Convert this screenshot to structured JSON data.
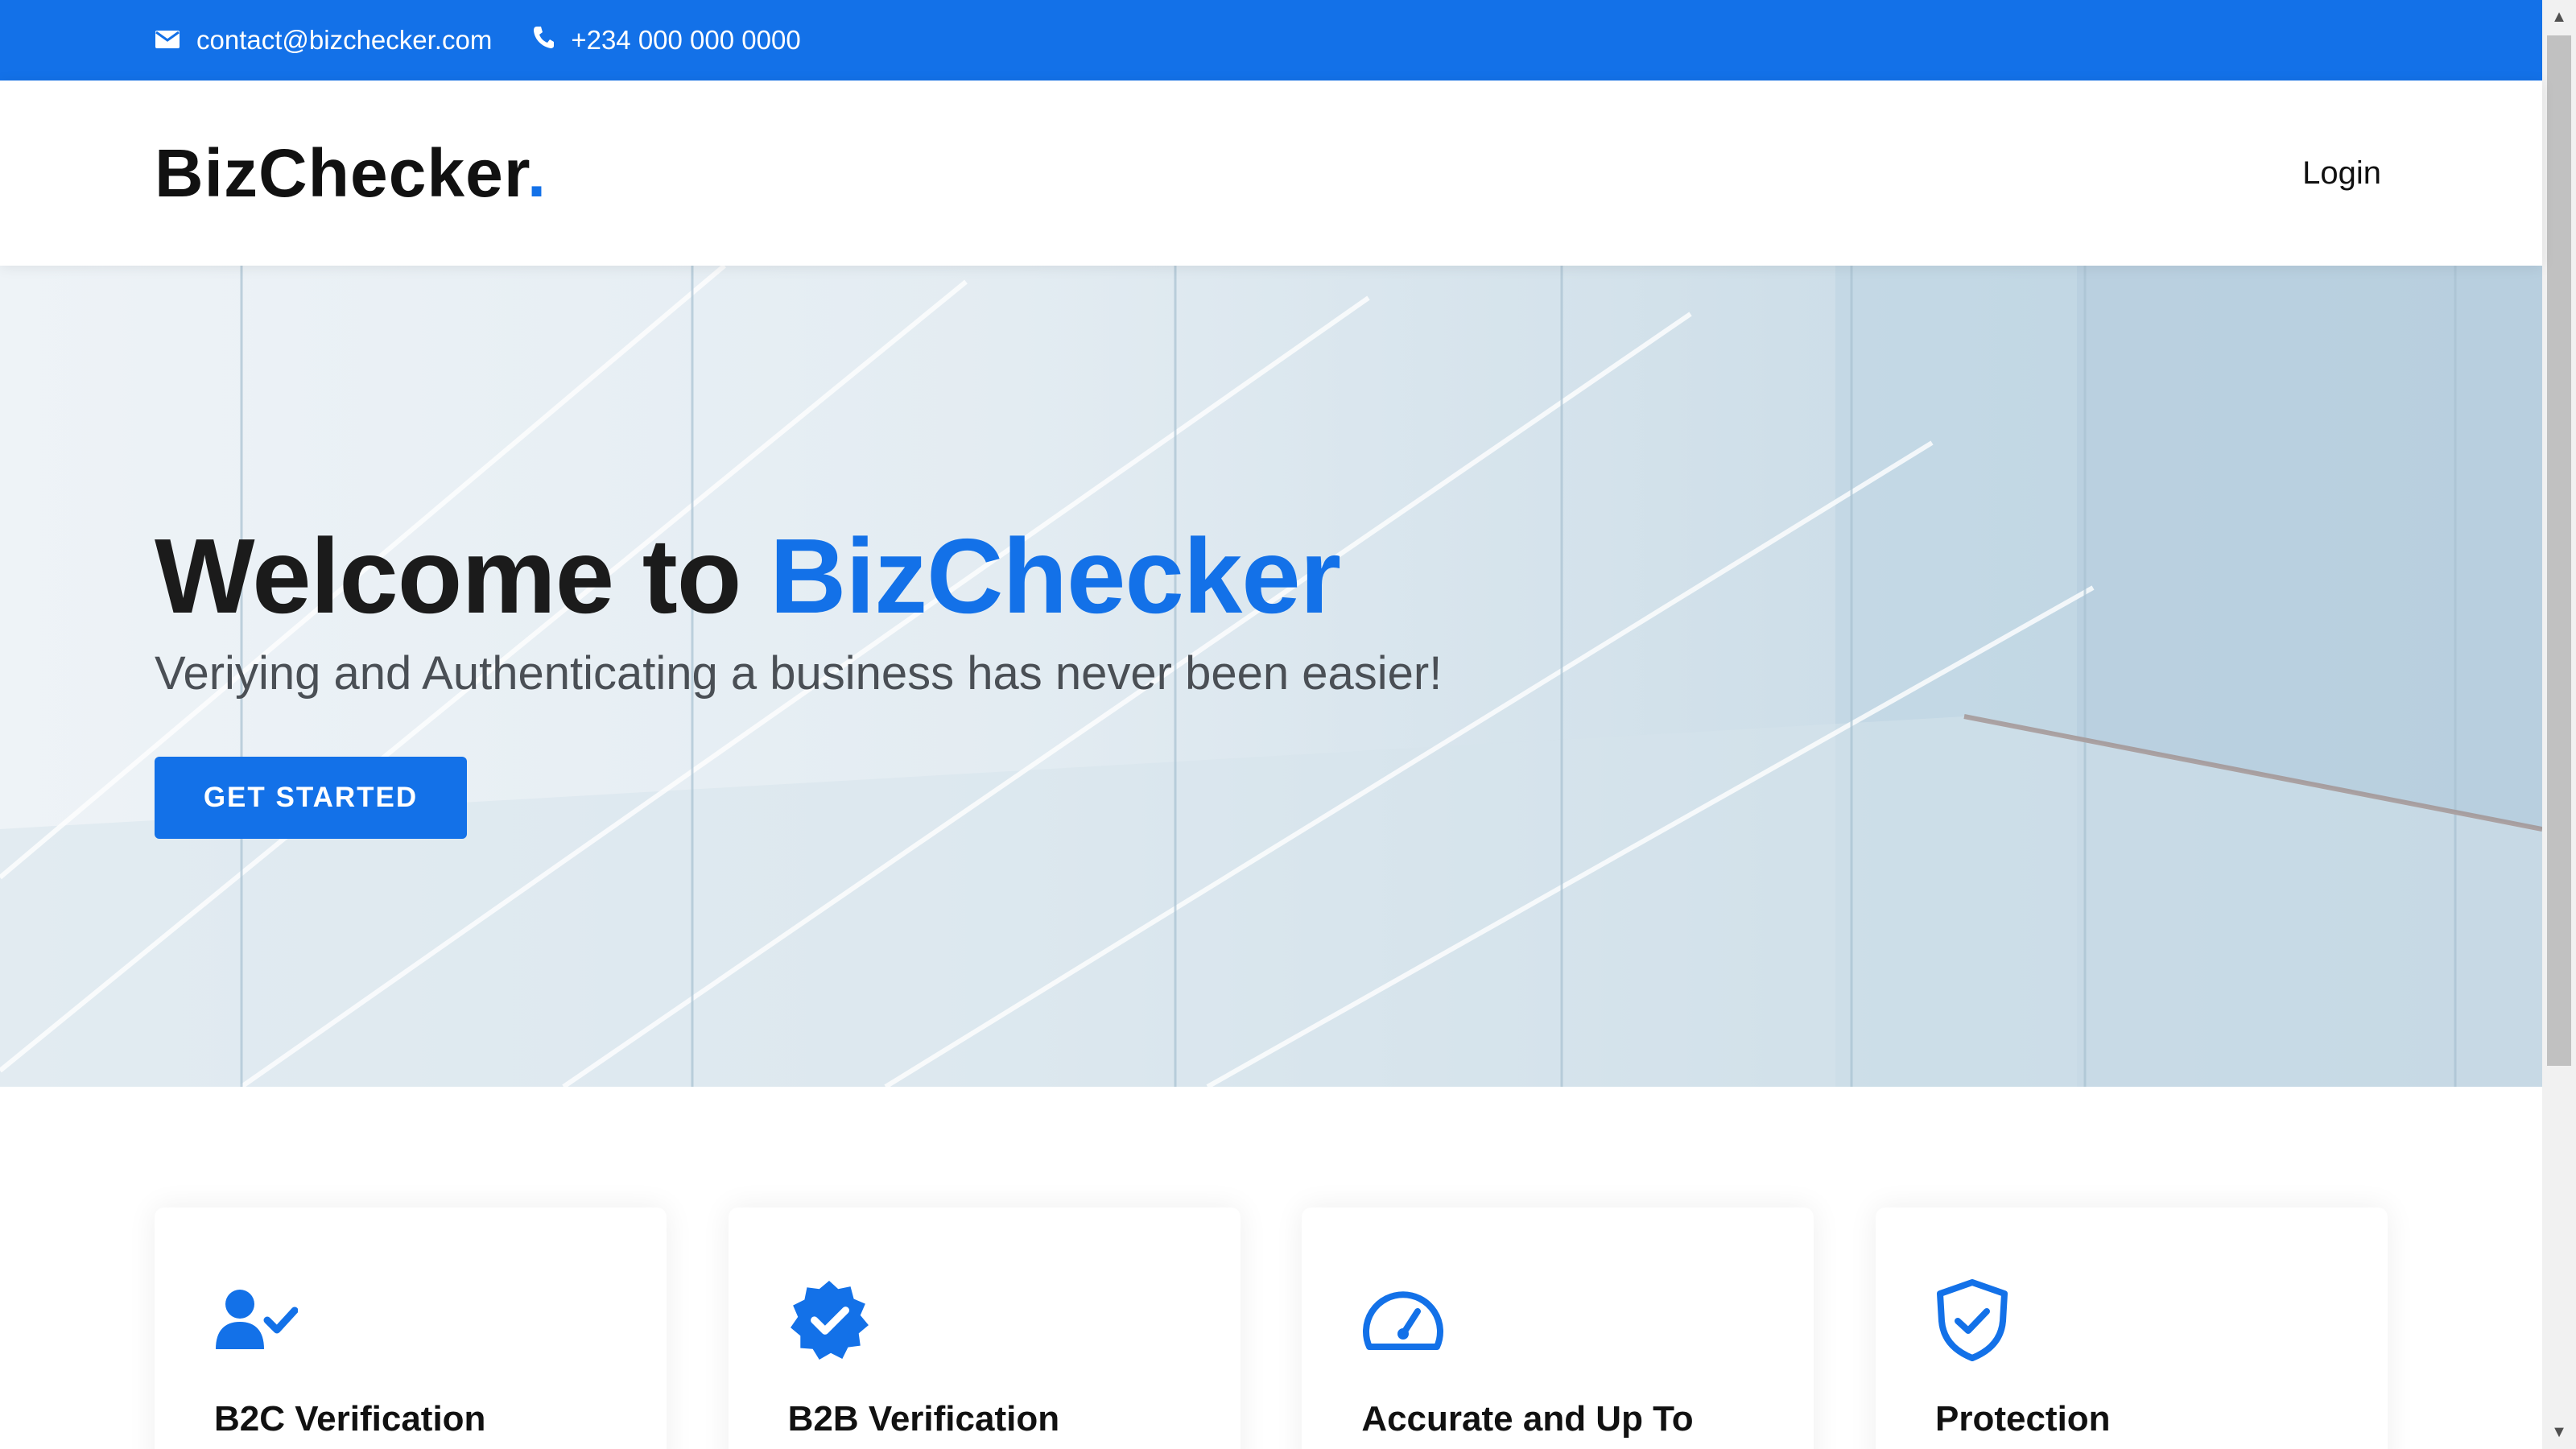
{
  "topbar": {
    "email": "contact@bizchecker.com",
    "phone": "+234 000 000 0000"
  },
  "header": {
    "logo_text": "BizChecker",
    "logo_dot": ".",
    "login_label": "Login"
  },
  "hero": {
    "title_prefix": "Welcome to ",
    "title_brand": "BizChecker",
    "subtitle": "Veriying and Authenticating a business has never been easier!",
    "cta_label": "GET STARTED"
  },
  "features": [
    {
      "title": "B2C Verification",
      "icon": "user-check-icon"
    },
    {
      "title": "B2B Verification",
      "icon": "verified-badge-icon"
    },
    {
      "title": "Accurate and Up To",
      "icon": "speedometer-icon"
    },
    {
      "title": "Protection",
      "icon": "shield-check-icon"
    }
  ],
  "colors": {
    "accent": "#1371e8",
    "text_dark": "#1b1b1b",
    "subtitle": "#4a4f55"
  }
}
